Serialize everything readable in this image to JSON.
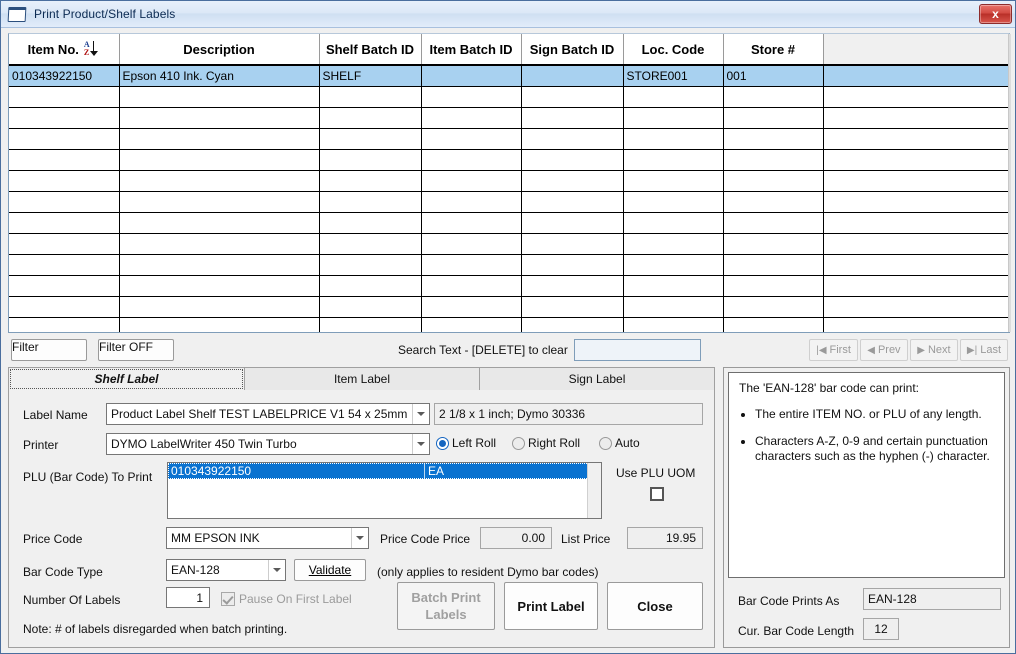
{
  "window": {
    "title": "Print Product/Shelf Labels",
    "icon": "window-document-icon",
    "close_label": "x"
  },
  "grid": {
    "columns": [
      {
        "label": "Item No.",
        "sort_icon": "sort-az-descending-icon"
      },
      {
        "label": "Description"
      },
      {
        "label": "Shelf Batch ID"
      },
      {
        "label": "Item Batch ID"
      },
      {
        "label": "Sign Batch ID"
      },
      {
        "label": "Loc. Code"
      },
      {
        "label": "Store #"
      }
    ],
    "rows": [
      {
        "selected": true,
        "item_no": "010343922150",
        "description": "Epson 410 Ink. Cyan",
        "shelf_batch_id": "SHELF",
        "item_batch_id": "",
        "sign_batch_id": "",
        "loc_code": "STORE001",
        "store_no": "001"
      }
    ],
    "empty_row_count": 12
  },
  "filter_bar": {
    "filter_label": "Filter",
    "filter_off_label": "Filter OFF",
    "search_label": "Search Text - [DELETE] to clear",
    "search_value": "",
    "search_placeholder": "",
    "nav": [
      {
        "label": "First",
        "glyph": "|◀"
      },
      {
        "label": "Prev",
        "glyph": "◀"
      },
      {
        "label": "Next",
        "glyph": "▶"
      },
      {
        "label": "Last",
        "glyph": "▶|"
      }
    ]
  },
  "tabs": [
    {
      "label": "Shelf Label",
      "active": true
    },
    {
      "label": "Item Label",
      "active": false
    },
    {
      "label": "Sign Label",
      "active": false
    }
  ],
  "form": {
    "label_name_label": "Label Name",
    "label_name_value": "Product Label Shelf TEST LABELPRICE V1 54 x 25mm",
    "label_size_value": "2 1/8 x 1 inch; Dymo 30336",
    "printer_label": "Printer",
    "printer_value": "DYMO LabelWriter 450 Twin Turbo",
    "roll_options": [
      {
        "label": "Left Roll",
        "selected": true
      },
      {
        "label": "Right Roll",
        "selected": false
      },
      {
        "label": "Auto",
        "selected": false
      }
    ],
    "plu_label": "PLU (Bar Code) To Print",
    "plu_rows": [
      {
        "code": "010343922150",
        "uom": "EA",
        "selected": true
      }
    ],
    "use_plu_uom_label": "Use PLU UOM",
    "use_plu_uom_checked": false,
    "price_code_label": "Price Code",
    "price_code_value": "MM EPSON INK",
    "price_code_price_label": "Price Code Price",
    "price_code_price_value": "0.00",
    "list_price_label": "List Price",
    "list_price_value": "19.95",
    "bar_code_type_label": "Bar Code Type",
    "bar_code_type_value": "EAN-128",
    "validate_label": "Validate",
    "validate_note": "(only applies to resident Dymo bar codes)",
    "number_of_labels_label": "Number Of Labels",
    "number_of_labels_value": "1",
    "pause_label": "Pause On First Label",
    "pause_checked": true,
    "pause_disabled": true,
    "note": "Note: # of labels disregarded when batch printing.",
    "batch_print_label_line1": "Batch Print",
    "batch_print_label_line2": "Labels",
    "print_label_label": "Print Label",
    "close_label": "Close"
  },
  "info": {
    "intro": "The 'EAN-128' bar code can print:",
    "bullets": [
      "The entire ITEM NO. or PLU of any length.",
      "Characters A-Z, 0-9 and certain punctuation characters such as the hyphen (-) character."
    ],
    "prints_as_label": "Bar Code Prints As",
    "prints_as_value": "EAN-128",
    "length_label": "Cur. Bar Code Length",
    "length_value": "12"
  },
  "colors": {
    "selection_blue": "#a8d1f0",
    "batch_yellow": "#ffffa8",
    "plu_select_blue": "#0a72d0",
    "accent_radio": "#1565c0"
  }
}
